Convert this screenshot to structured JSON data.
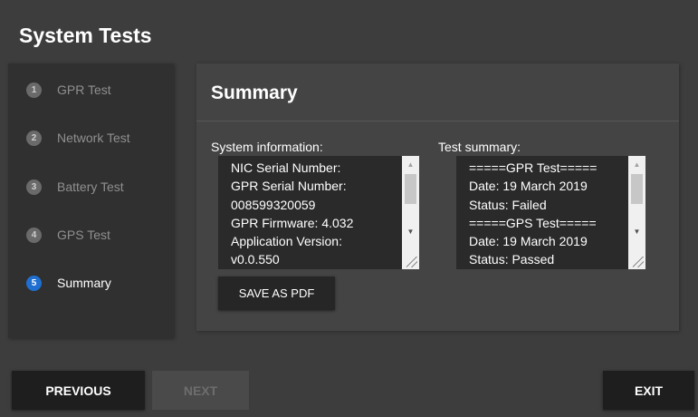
{
  "window": {
    "title": "System Tests"
  },
  "steps": [
    {
      "number": "1",
      "label": "GPR Test"
    },
    {
      "number": "2",
      "label": "Network Test"
    },
    {
      "number": "3",
      "label": "Battery Test"
    },
    {
      "number": "4",
      "label": "GPS Test"
    },
    {
      "number": "5",
      "label": "Summary"
    }
  ],
  "active_step": "5",
  "summary": {
    "heading": "Summary",
    "system_info_label": "System information:",
    "system_info_lines": [
      "NIC Serial Number:",
      "GPR Serial Number:",
      "008599320059",
      "GPR Firmware: 4.032",
      "Application Version:",
      "v0.0.550"
    ],
    "test_summary_label": "Test summary:",
    "test_summary_lines": [
      "=====GPR Test=====",
      "Date: 19 March 2019",
      "Status: Failed",
      "=====GPS Test=====",
      "Date: 19 March 2019",
      "Status: Passed"
    ],
    "save_button": "SAVE AS PDF"
  },
  "footer": {
    "previous": "PREVIOUS",
    "next": "NEXT",
    "exit": "EXIT"
  },
  "colors": {
    "background": "#3d3d3d",
    "active_step": "#1f6fd0",
    "button_dark": "#1e1e1e",
    "button_disabled": "#4a4a4a"
  },
  "icons": {
    "scroll_up": "scroll-up-arrow-icon",
    "scroll_down": "scroll-down-arrow-icon",
    "resize_grip": "resize-grip-icon"
  }
}
